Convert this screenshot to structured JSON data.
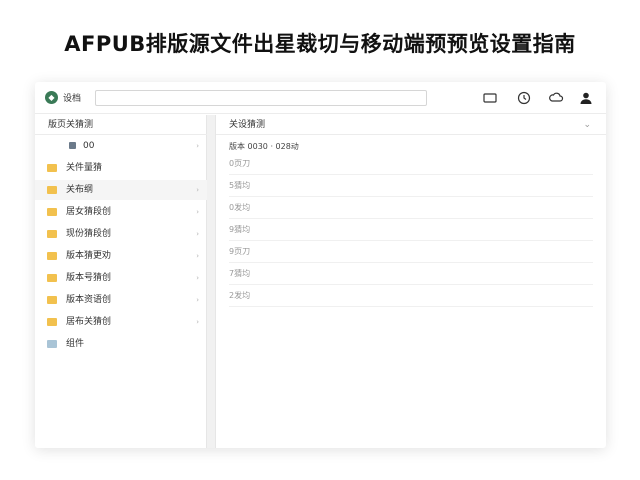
{
  "headline": "AFPUB排版源文件出星裁切与移动端预预览设置指南",
  "app": {
    "logo_icon": "app-logo-icon",
    "title": "设档",
    "search_value": ""
  },
  "toolbar": {
    "icons": [
      "display-icon",
      "clock-icon",
      "cloud-icon",
      "user-icon"
    ]
  },
  "sidebar": {
    "header": "版页关猜测",
    "items": [
      {
        "label": "00",
        "icon": "file-icon",
        "color": "#6b7a8a",
        "type": "sub",
        "arrow": "›"
      },
      {
        "label": "关件量猜",
        "icon": "folder-icon",
        "color": "#f2c14e",
        "type": "folder",
        "arrow": ""
      },
      {
        "label": "关布纲",
        "icon": "folder-icon",
        "color": "#f2c14e",
        "type": "folder",
        "arrow": "›",
        "selected": true
      },
      {
        "label": "居女猜段创",
        "icon": "folder-icon",
        "color": "#f2c14e",
        "type": "folder",
        "arrow": "›"
      },
      {
        "label": "现份猜段创",
        "icon": "folder-icon",
        "color": "#f2c14e",
        "type": "folder",
        "arrow": "›"
      },
      {
        "label": "版本猜更劝",
        "icon": "folder-icon",
        "color": "#f2c14e",
        "type": "folder",
        "arrow": "›"
      },
      {
        "label": "版本号猜创",
        "icon": "folder-icon",
        "color": "#f2c14e",
        "type": "folder",
        "arrow": "›"
      },
      {
        "label": "版本资语创",
        "icon": "folder-icon",
        "color": "#f2c14e",
        "type": "folder",
        "arrow": "›"
      },
      {
        "label": "居布关猜创",
        "icon": "folder-icon",
        "color": "#f2c14e",
        "type": "folder",
        "arrow": "›"
      },
      {
        "label": "组件",
        "icon": "image-icon",
        "color": "#a9c4d6",
        "type": "folder",
        "arrow": ""
      }
    ]
  },
  "main": {
    "header": "关设猜测",
    "chevron": "⌄",
    "subheader": "版本 0030 · 028动",
    "rows": [
      "0页刀",
      "5猜均",
      "0发均",
      "9猜均",
      "9页刀",
      "7猜均",
      "2发均"
    ]
  }
}
